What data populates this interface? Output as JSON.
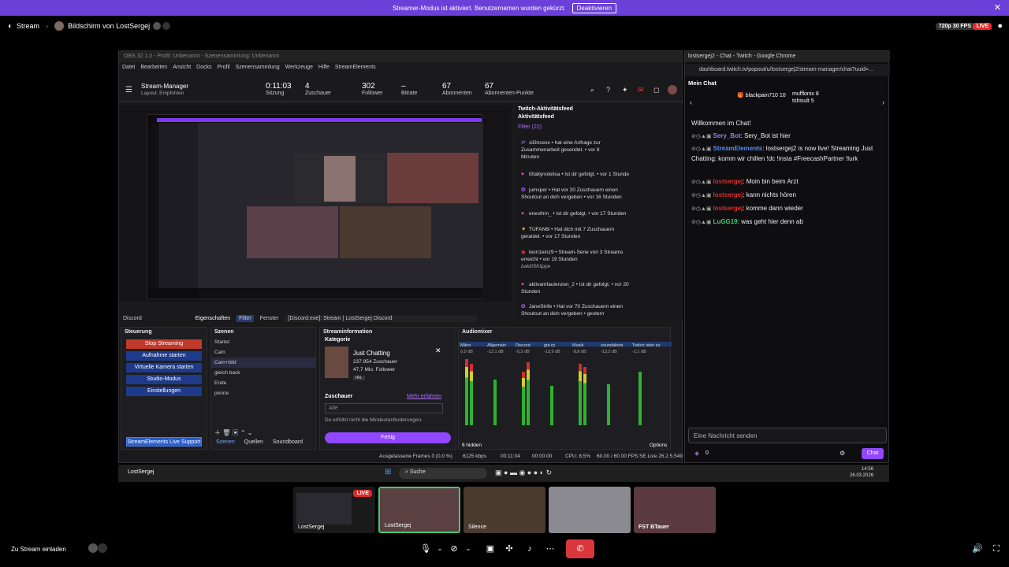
{
  "banner": {
    "text": "Streamer-Modus ist aktiviert. Benutzernamen wurden gekürzt.",
    "button": "Deaktivieren",
    "close": "✕"
  },
  "topbar": {
    "stream_label": "Stream",
    "title": "Bildschirm von LostSergej",
    "quality": "720p 30 FPS",
    "live": "LIVE"
  },
  "obs": {
    "title": "OBS 32.1.0 - Profil: Unbenannt - Szenensammlung: Unbenannt",
    "menu": [
      "Datei",
      "Bearbeiten",
      "Ansicht",
      "Docks",
      "Profil",
      "Szenensammlung",
      "Werkzeuge",
      "Hilfe",
      "StreamElements"
    ],
    "manager_title": "Stream-Manager",
    "manager_layout": "Layout: Empfohlen",
    "stats": [
      {
        "value": "0:11:03",
        "label": "Sitzung"
      },
      {
        "value": "4",
        "label": "Zuschauer"
      },
      {
        "value": "302",
        "label": "Follower"
      },
      {
        "value": "–",
        "label": "Bitrate"
      },
      {
        "value": "67",
        "label": "Abonnenten"
      },
      {
        "value": "67",
        "label": "Abonnenten-Punkte"
      }
    ],
    "activity": {
      "title": "Twitch-Aktivitätsfeed",
      "subtitle": "Aktivitätsfeed",
      "filter": "Filter (22)",
      "items": [
        {
          "line1": "sil3ncexx • hat eine Anfrage zur",
          "line2": "Zusammenarbeit gesendet. • vor 8",
          "line3": "Minuten"
        },
        {
          "line1": "t0tallynotelisa • Ist dir gefolgt. • vor 1 Stunde",
          "line2": "",
          "line3": ""
        },
        {
          "line1": "jumxper • Hat vor 20 Zuschauern einen",
          "line2": "Shoutout an dich vergeben • vor 16 Stunden",
          "line3": ""
        },
        {
          "line1": "enesfmn_ • Ist dir gefolgt. • vor 17 Stunden",
          "line2": "",
          "line3": ""
        },
        {
          "line1": "TUFAN6l • Hat dich mit 7 Zuschauern",
          "line2": "geraidet. • vor 17 Stunden",
          "line3": ""
        },
        {
          "line1": "leon1einz9 • Stream-Serie von 3 Streams",
          "line2": "erreicht • vor 19 Stunden",
          "line3": "baki05Klippe"
        },
        {
          "line1": "aktivamfaulenzen_2 • Ist dir gefolgt. • vor 20",
          "line2": "Stunden",
          "line3": ""
        },
        {
          "line1": "JaneStrife • Hat vor 70 Zuschauern einen",
          "line2": "Shoutout an dich vergeben • gestern",
          "line3": ""
        }
      ]
    },
    "source_bar": {
      "source": "Discord",
      "props": "Eigenschaften",
      "filter": "Filter",
      "window_label": "Fenster",
      "window_value": "[Discord.exe]: Stream | LostSergej Discord"
    },
    "steuerung": {
      "title": "Steuerung",
      "stop": "Stop Streaming",
      "record": "Aufnahme starten",
      "virtual": "Virtuelle Kamera starten",
      "studio": "Studio-Modus",
      "settings": "Einstellungen",
      "support": "StreamElements Live Support"
    },
    "szenen": {
      "title": "Szenen",
      "items": [
        "Startet",
        "Cam",
        "Cam+bild",
        "gleich back",
        "Ende",
        "penne"
      ],
      "tabs": [
        "Szenen",
        "Quellen",
        "Soundboard"
      ]
    },
    "streaminfo": {
      "title": "Streaminformation",
      "category_label": "Kategorie",
      "category": "Just Chatting",
      "viewers": "237.954 Zuschauer",
      "followers": "47,7 Mio. Follower",
      "tag": "IRL",
      "audience_label": "Zuschauer",
      "more": "Mehr erfahren",
      "select": "Alle",
      "note": "Du erfüllst nicht die Mindestanforderungen.",
      "done": "Fertig"
    },
    "mixer": {
      "title": "Audiomixer",
      "channels": [
        "Mikro",
        "Allgemein",
        "Discord",
        "gta rp",
        "Musik",
        "soundalerts",
        "Twitch oder so"
      ],
      "levels": [
        "0,0 dB",
        "-13,1 dB",
        "-5,2 dB",
        "-13,9 dB",
        "-8,8 dB",
        "-13,2 dB",
        "-2,1 dB"
      ],
      "hidden": "6 hidden",
      "options": "Options"
    },
    "status": {
      "frames": "Ausgelassene Frames 0 (0,0 %)",
      "kbps": "6125 kbps",
      "time": "00:11:04",
      "rec": "00:00:00",
      "cpu": "CPU: 8,5%",
      "fps": "60.00 / 60.00 FPS",
      "version": "SE.Live 26.2.5.549"
    }
  },
  "chat": {
    "window_title": "lostsergej2 - Chat - Twitch - Google Chrome",
    "url": "dashboard.twitch.tv/popout/u/lostsergej2/stream-manager/chat?uuid=...",
    "header": "Mein Chat",
    "leaders": [
      {
        "name": "blackpain710",
        "count": "10"
      },
      {
        "name": "mufflonix",
        "count": "8"
      },
      {
        "name": "tshisult",
        "count": "5"
      }
    ],
    "welcome": "Willkommen im Chat!",
    "messages": [
      {
        "user": "Sery_Bot",
        "color": "#8f7ff0",
        "text": ": Sery_Bot ist hier"
      },
      {
        "user": "StreamElements",
        "color": "#5b8cf0",
        "text": ": lostsergej2 is now live! Streaming Just Chatting: komm wir chillen !dc !insta #FreecashPartner !lurk"
      },
      {
        "user": "lostsergej",
        "color": "#e02a2a",
        "text": ": Moin bin beim Arzt"
      },
      {
        "user": "lostsergej",
        "color": "#e02a2a",
        "text": ": kann nichts hören"
      },
      {
        "user": "lostsergej",
        "color": "#e02a2a",
        "text": ": komme dann wieder"
      },
      {
        "user": "LuGG19",
        "color": "#3aca7a",
        "text": ": was geht hier denn ab"
      }
    ],
    "input_placeholder": "Eine Nachricht senden",
    "points": "0",
    "send": "Chat"
  },
  "taskbar": {
    "user": "LostSergej",
    "search": "Suche",
    "time": "14:56",
    "date": "26.03.2026"
  },
  "participants": [
    {
      "name": "LostSergej",
      "live": "LIVE"
    },
    {
      "name": "LostSergej"
    },
    {
      "name": "Silence"
    },
    {
      "name": ""
    },
    {
      "name": "FST BTauer"
    }
  ],
  "footer": {
    "invite": "Zu Stream einladen"
  }
}
